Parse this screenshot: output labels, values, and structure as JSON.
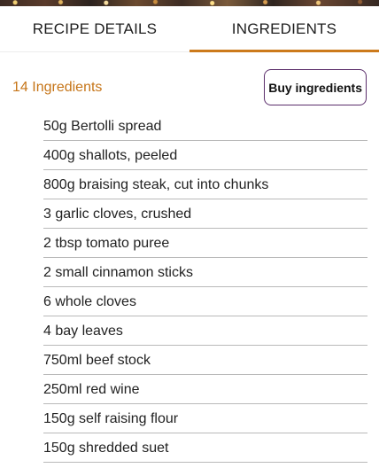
{
  "tabs": [
    {
      "label": "RECIPE DETAILS",
      "active": false
    },
    {
      "label": "INGREDIENTS",
      "active": true
    }
  ],
  "summary": {
    "count_label": "14 Ingredients",
    "buy_button_label": "Buy ingredients"
  },
  "ingredients": [
    "50g Bertolli spread",
    "400g shallots, peeled",
    "800g braising steak, cut into chunks",
    "3 garlic cloves, crushed",
    "2 tbsp tomato puree",
    "2 small cinnamon sticks",
    "6 whole cloves",
    "4 bay leaves",
    "750ml beef stock",
    "250ml red wine",
    "150g self raising flour",
    "150g shredded suet"
  ],
  "colors": {
    "accent": "#cc7a1c",
    "count_text": "#c67518",
    "button_border": "#5b2e6b",
    "divider": "#b9b9b9"
  }
}
